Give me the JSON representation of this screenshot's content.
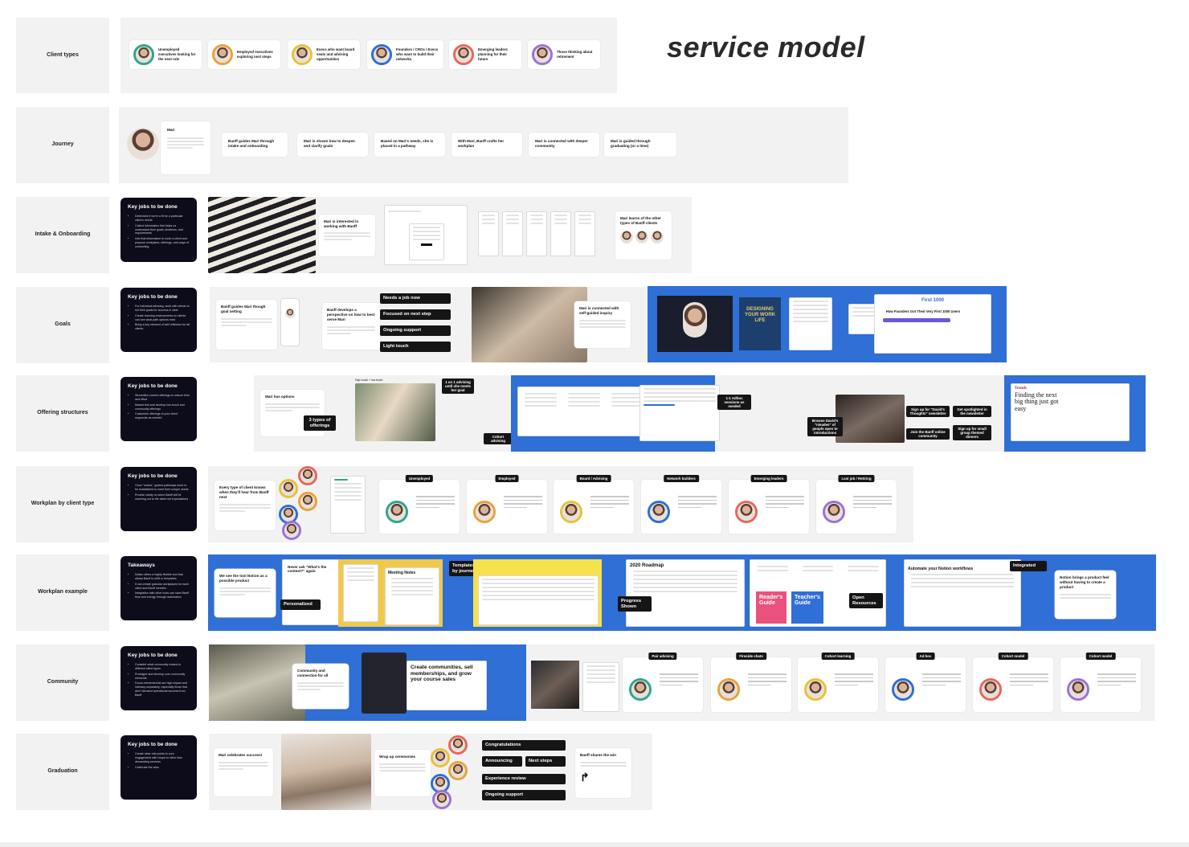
{
  "title": "service model",
  "rows": [
    {
      "id": "client-types",
      "label": "Client types"
    },
    {
      "id": "journey",
      "label": "Journey"
    },
    {
      "id": "intake",
      "label": "Intake & Onboarding"
    },
    {
      "id": "goals",
      "label": "Goals"
    },
    {
      "id": "offering",
      "label": "Offering structures"
    },
    {
      "id": "workplan",
      "label": "Workplan by client type"
    },
    {
      "id": "workplan-example",
      "label": "Workplan example"
    },
    {
      "id": "community",
      "label": "Community"
    },
    {
      "id": "graduation",
      "label": "Graduation"
    }
  ],
  "client_types": [
    {
      "label": "Unemployed executives looking for the next role",
      "color": "#2fa58f"
    },
    {
      "label": "Employed executives exploring next steps",
      "color": "#e9a23b"
    },
    {
      "label": "Execs who want board seats and advising opportunities",
      "color": "#e7c23a"
    },
    {
      "label": "Founders / CROs / Execs who want to build their networks",
      "color": "#2f6fd6"
    },
    {
      "label": "Emerging leaders planning for their future",
      "color": "#e8675d"
    },
    {
      "label": "Those thinking about retirement",
      "color": "#9a72d8"
    }
  ],
  "journey": {
    "persona_name": "Mari",
    "steps": [
      "Banff guides Mari through intake and onboarding",
      "Mari is shown how to deepen and clarify goals",
      "Based on Mari's needs, she is placed in a pathway",
      "With Mari, Banff crafts her workplan",
      "Mari is connected with deeper community",
      "Mari is guided through graduating (or a time)"
    ]
  },
  "intake": {
    "heading": "Key jobs to be done",
    "bullets": [
      "Determine if we're a fit for a particular client's needs",
      "Collect information that helps us understand their goals, timelines, and requirements",
      "Use that information to route a client and propose workplans, offerings, and ways of connecting"
    ],
    "card1": "Mari is interested in working with Banff",
    "card2": "Mari learns of the other types of Banff clients"
  },
  "goals": {
    "heading": "Key jobs to be done",
    "bullets": [
      "For individual advising, work with clients to set their goals for success & clear",
      "Create learning environments so clients can see what path options exist",
      "Bring a key element of self-reflection for all clients."
    ],
    "card1": "Banff guides Mari though goal setting",
    "card2": "Banff develops a perspective on how to best serve Mari",
    "chips": [
      "Needs a job now",
      "Focused on next step",
      "Ongoing support",
      "Light touch"
    ],
    "card3": "Mari is connected with self-guided inquiry",
    "book_title": "DESIGNING YOUR WORK LIFE",
    "first_label": "First 1000",
    "first_sub": "How Founders Got Their Very First 1000 Users"
  },
  "offering": {
    "heading": "Key jobs to be done",
    "bullets": [
      "Streamline current offerings to reduce time and effort",
      "Market test and develop low-touch and community offerings",
      "Customize offerings to your client segments as needed"
    ],
    "card1": "Mari has options",
    "chip_offerings": "3 types of offerings",
    "high_touch": "High touch + low touch",
    "tag_1on1": "1 on 1 advising until she meets her goal",
    "tag_cohort": "Cohort advising",
    "tag_adhoc": "1-1 Adhoc sessions as needed",
    "tag_browse": "Browse David's \"nieades\" of people open to introductions",
    "tag_signup1": "Sign up for \"David's Thoughts\" newsletter",
    "tag_spotlight": "Get spotlighted in the newsletter",
    "tag_join": "Join the Banff online community",
    "tag_small": "Sign up for small group themed dinners",
    "trends_title": "Finding the next big thing just got easy",
    "trends_brand": "Trends"
  },
  "workplan": {
    "heading": "Key jobs to be done",
    "bullets": [
      "Once \"routed,\" guided pathways need to be established to meet their unique needs",
      "Provide clarity on when Banff will be reaching out to the client set expectations"
    ],
    "card1": "Every type of client knows when they'll hear from Banff next",
    "types": [
      "Unemployed",
      "Employed",
      "Board / Advising",
      "Network builders",
      "Emerging leaders",
      "Last job / Retiring"
    ]
  },
  "workplan_example": {
    "heading": "Takeaways",
    "bullets": [
      "Notion offers a highly flexible tool that allows Banff to shift or templates",
      "It can create granular workplaces for each client and Banff member",
      "Integration with other tools can save Banff time and energy through automation"
    ],
    "card1": "We see the tool Notion as a possible product",
    "card_never": "Never ask \"What's the context?\" again",
    "chip_personalized": "Personalized",
    "meeting_notes": "Meeting Notes",
    "chip_templates": "Templates by journey",
    "chip_progress": "Progress Shown",
    "roadmap": "2020 Roadmap",
    "chip_readers": "Reader's Guide",
    "chip_teachers": "Teacher's Guide",
    "chip_open": "Open Resources",
    "automate": "Automate your Notion workflows",
    "chip_integrated": "Integrated",
    "card_product": "Notion brings a product feel without having to create a product"
  },
  "community": {
    "heading": "Key jobs to be done",
    "bullets": [
      "Consider what community means to different client types",
      "Prototype and develop core community elements",
      "Focus elements that are high impact and intimacy separately, especially those that don't demand operational success from Banff"
    ],
    "card1": "Community and connection for all",
    "sell_title": "Create communities, sell memberships, and grow your course sales",
    "types": [
      "Pair advising",
      "Fireside chats",
      "Cohort learning",
      "Ad hoc",
      "Cohort model",
      "Cohort model"
    ]
  },
  "graduation": {
    "heading": "Key jobs to be done",
    "bullets": [
      "Create clear exit points to cure engagement with hoops to other less demanding services",
      "Celebrate the wins"
    ],
    "card1": "Mari celebrates success!",
    "card2": "Wrap up ceremonies",
    "chips": [
      "Congratulations",
      "Announcing",
      "Next steps",
      "Experience review",
      "Ongoing support"
    ],
    "card3": "Banff shares the win"
  }
}
